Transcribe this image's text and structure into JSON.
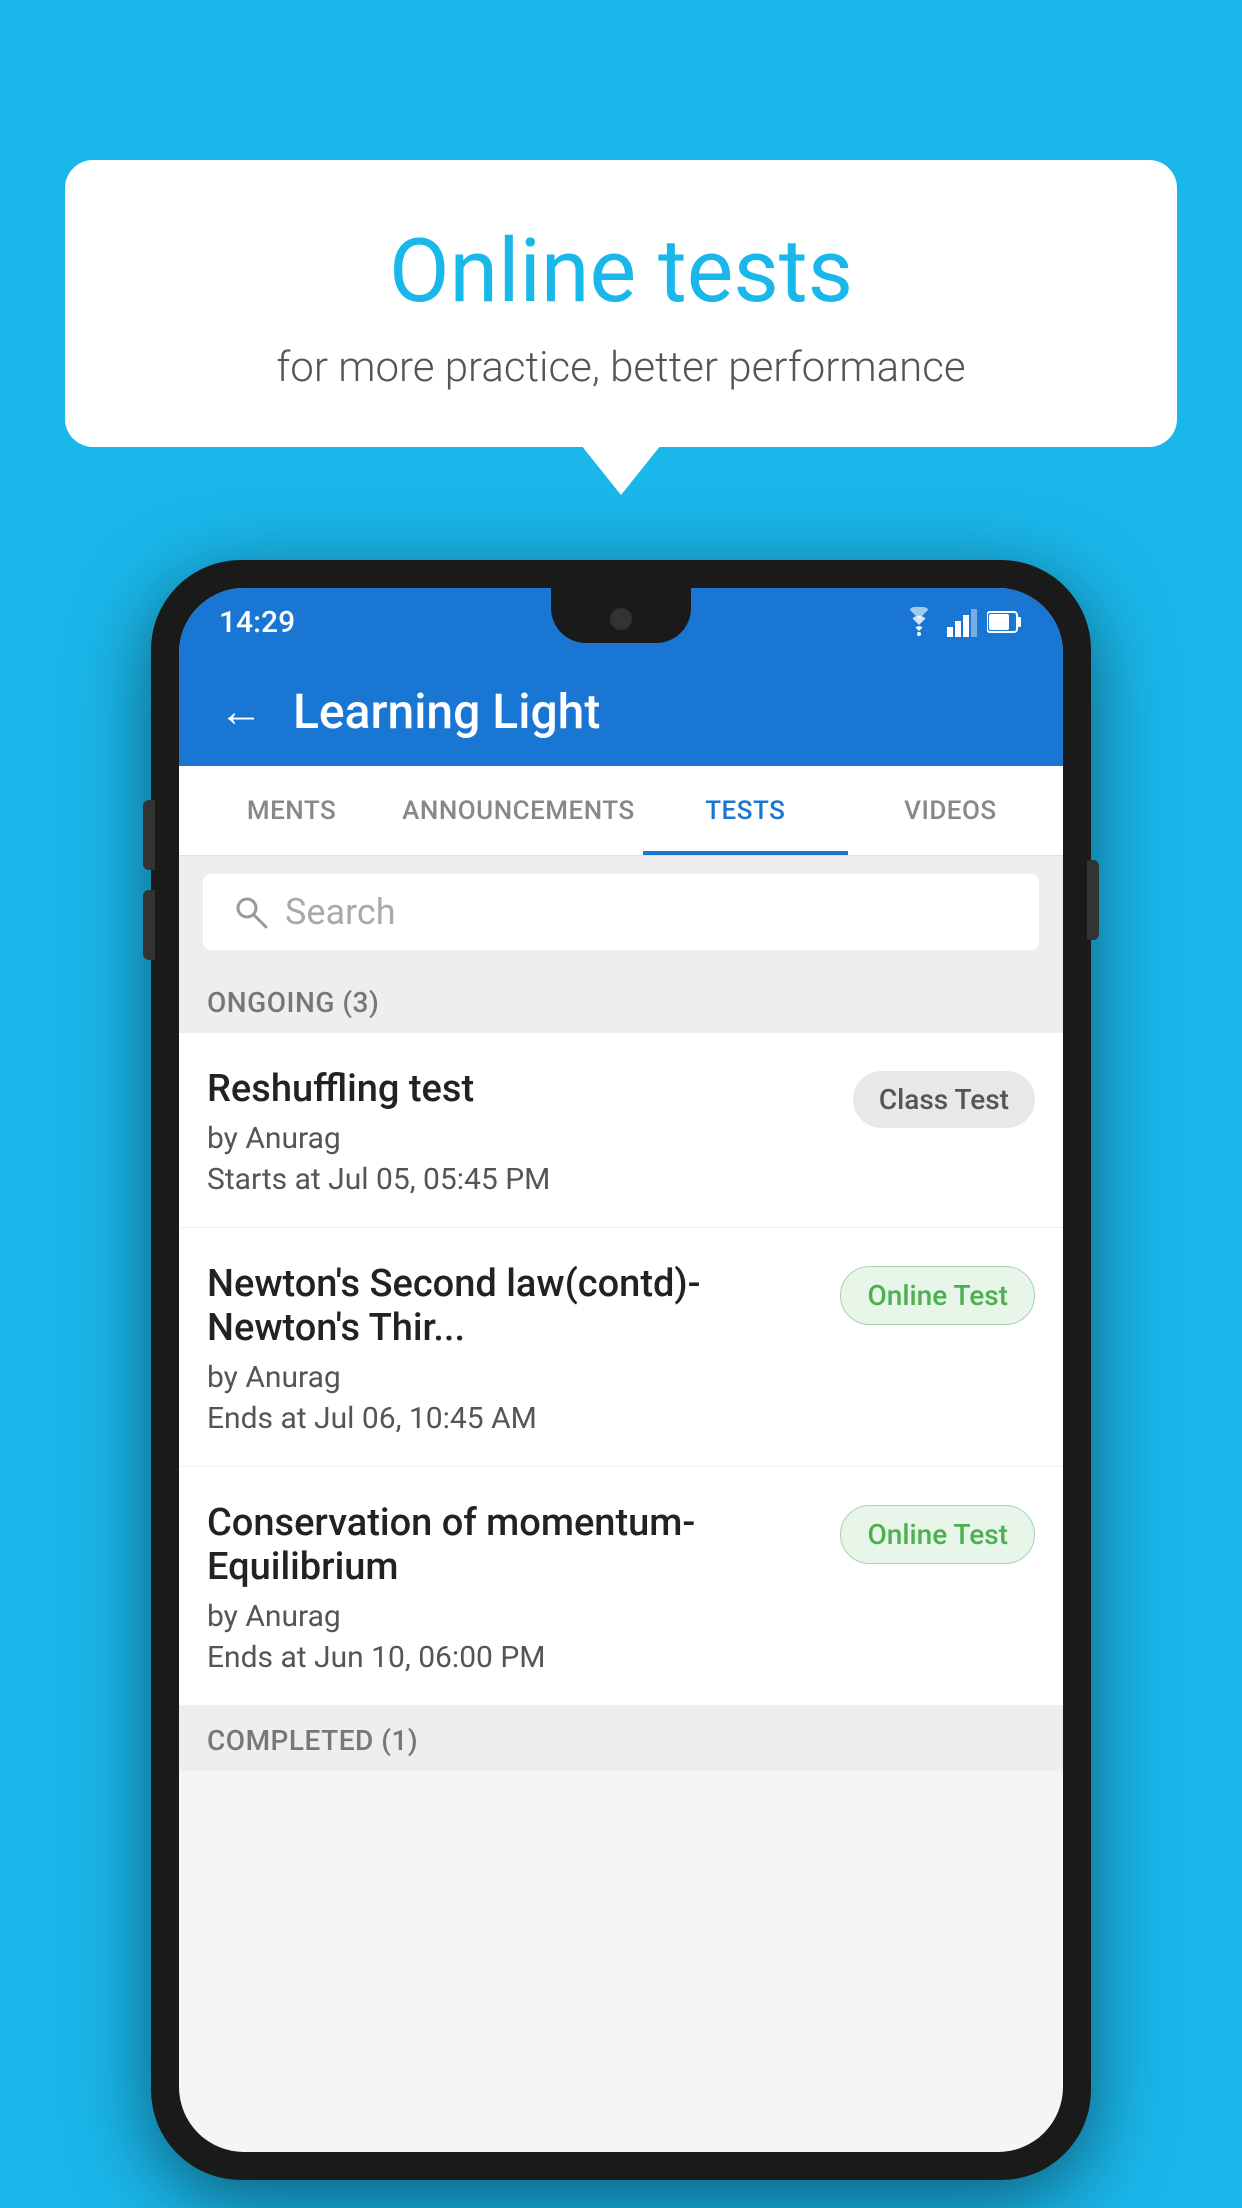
{
  "background_color": "#1ab7ea",
  "speech_bubble": {
    "title": "Online tests",
    "subtitle": "for more practice, better performance"
  },
  "phone": {
    "status_bar": {
      "time": "14:29",
      "icons": [
        "wifi",
        "signal",
        "battery"
      ]
    },
    "app_bar": {
      "title": "Learning Light",
      "back_label": "←"
    },
    "tabs": [
      {
        "label": "MENTS",
        "active": false
      },
      {
        "label": "ANNOUNCEMENTS",
        "active": false
      },
      {
        "label": "TESTS",
        "active": true
      },
      {
        "label": "VIDEOS",
        "active": false
      }
    ],
    "search": {
      "placeholder": "Search"
    },
    "section_ongoing": {
      "label": "ONGOING (3)"
    },
    "tests": [
      {
        "name": "Reshuffling test",
        "by": "by Anurag",
        "time": "Starts at  Jul 05, 05:45 PM",
        "badge": "Class Test",
        "badge_type": "class"
      },
      {
        "name": "Newton's Second law(contd)-Newton's Thir...",
        "by": "by Anurag",
        "time": "Ends at  Jul 06, 10:45 AM",
        "badge": "Online Test",
        "badge_type": "online"
      },
      {
        "name": "Conservation of momentum-Equilibrium",
        "by": "by Anurag",
        "time": "Ends at  Jun 10, 06:00 PM",
        "badge": "Online Test",
        "badge_type": "online"
      }
    ],
    "section_completed": {
      "label": "COMPLETED (1)"
    }
  }
}
